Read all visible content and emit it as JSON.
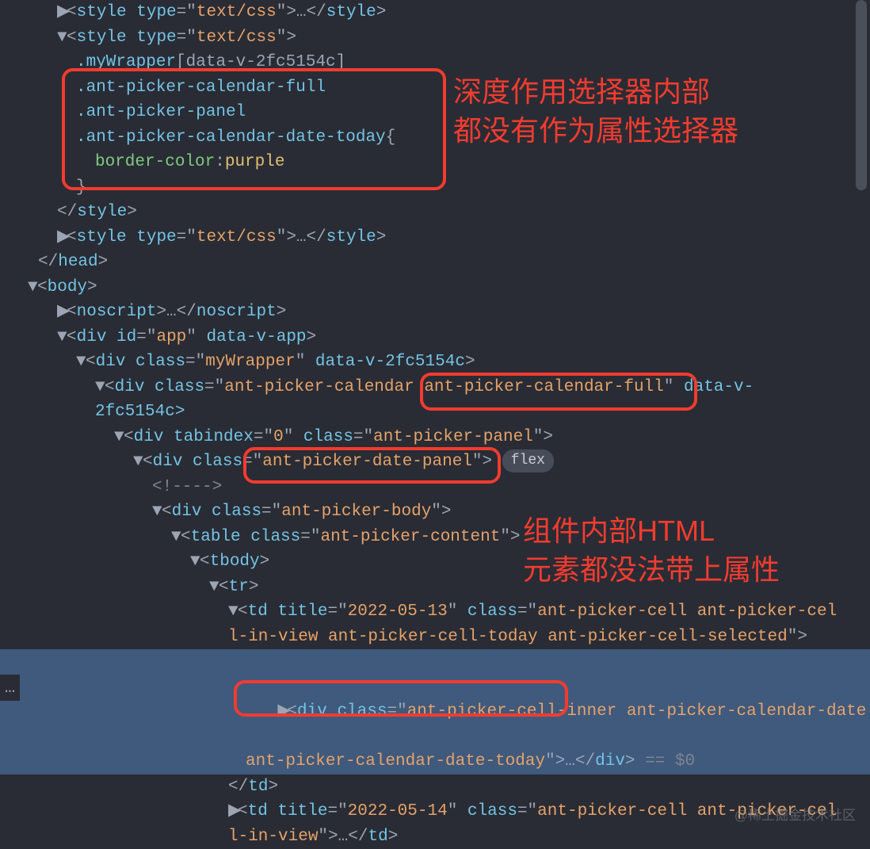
{
  "lines": {
    "style1_open": "<style type=\"text/css\">",
    "style1_ell": "…",
    "style1_close": "</style>",
    "style2_open": "<style type=\"text/css\">",
    "css_line1_pre": ".myWrapper",
    "css_line1_attr": "[data-v-2fc5154c]",
    "css_line2": ".ant-picker-calendar-full",
    "css_line3": ".ant-picker-panel",
    "css_line4": ".ant-picker-calendar-date-today",
    "css_brace_open": "{",
    "css_prop": "border-color",
    "css_colon": ":",
    "css_val": "purple",
    "css_brace_close": "}",
    "style2_close": "</style>",
    "style3_open": "<style type=\"text/css\">",
    "style3_ell": "…",
    "style3_close": "</style>",
    "head_close": "</head>",
    "body_open": "<body>",
    "noscript_open": "<noscript>",
    "noscript_ell": "…",
    "noscript_close": "</noscript>",
    "app_div": "<div id=\"app\" data-v-app>",
    "myWrapper_div": "<div class=\"myWrapper\" data-v-2fc5154c>",
    "cal_div_part1": "<div class=\"ant-picker-calendar ",
    "cal_div_highlight": "ant-picker-calendar-full",
    "cal_div_part2": "\" data-v-",
    "cal_div_cont": "2fc5154c>",
    "panel_div": "<div tabindex=\"0\" class=\"ant-picker-panel\">",
    "datepanel_div_pre": "<div class=\"",
    "datepanel_div_val": "ant-picker-date-panel",
    "datepanel_div_post": "\">",
    "flex_pill": "flex",
    "html_comment": "<!---->",
    "body_div": "<div class=\"ant-picker-body\">",
    "table_div": "<table class=\"ant-picker-content\">",
    "tbody": "<tbody>",
    "tr": "<tr>",
    "td1_open": "<td title=\"2022-05-13\" class=\"ant-picker-cell ant-picker-cel",
    "td1_cont": "l-in-view ant-picker-cell-today ant-picker-cell-selected\">",
    "inner_div_open": "<div class=\"ant-picker-cell-inner ant-picker-calendar-date",
    "inner_div_cont1": "ant-picker-calendar-date-today",
    "inner_div_cont2": "\">",
    "inner_div_ell": "…",
    "inner_div_close": "</div>",
    "eqzero": " == $0",
    "td1_close": "</td>",
    "td2_open": "<td title=\"2022-05-14\" class=\"ant-picker-cell ant-picker-cel",
    "td2_cont": "l-in-view\">",
    "td2_ell": "…",
    "td2_close": "</td>"
  },
  "annotations": {
    "anno1_line1": "深度作用选择器内部",
    "anno1_line2": "都没有作为属性选择器",
    "anno2_line1": "组件内部HTML",
    "anno2_line2": "元素都没法带上属性"
  },
  "watermark": "@稀土掘金技术社区",
  "ellipsis_badge": "…"
}
